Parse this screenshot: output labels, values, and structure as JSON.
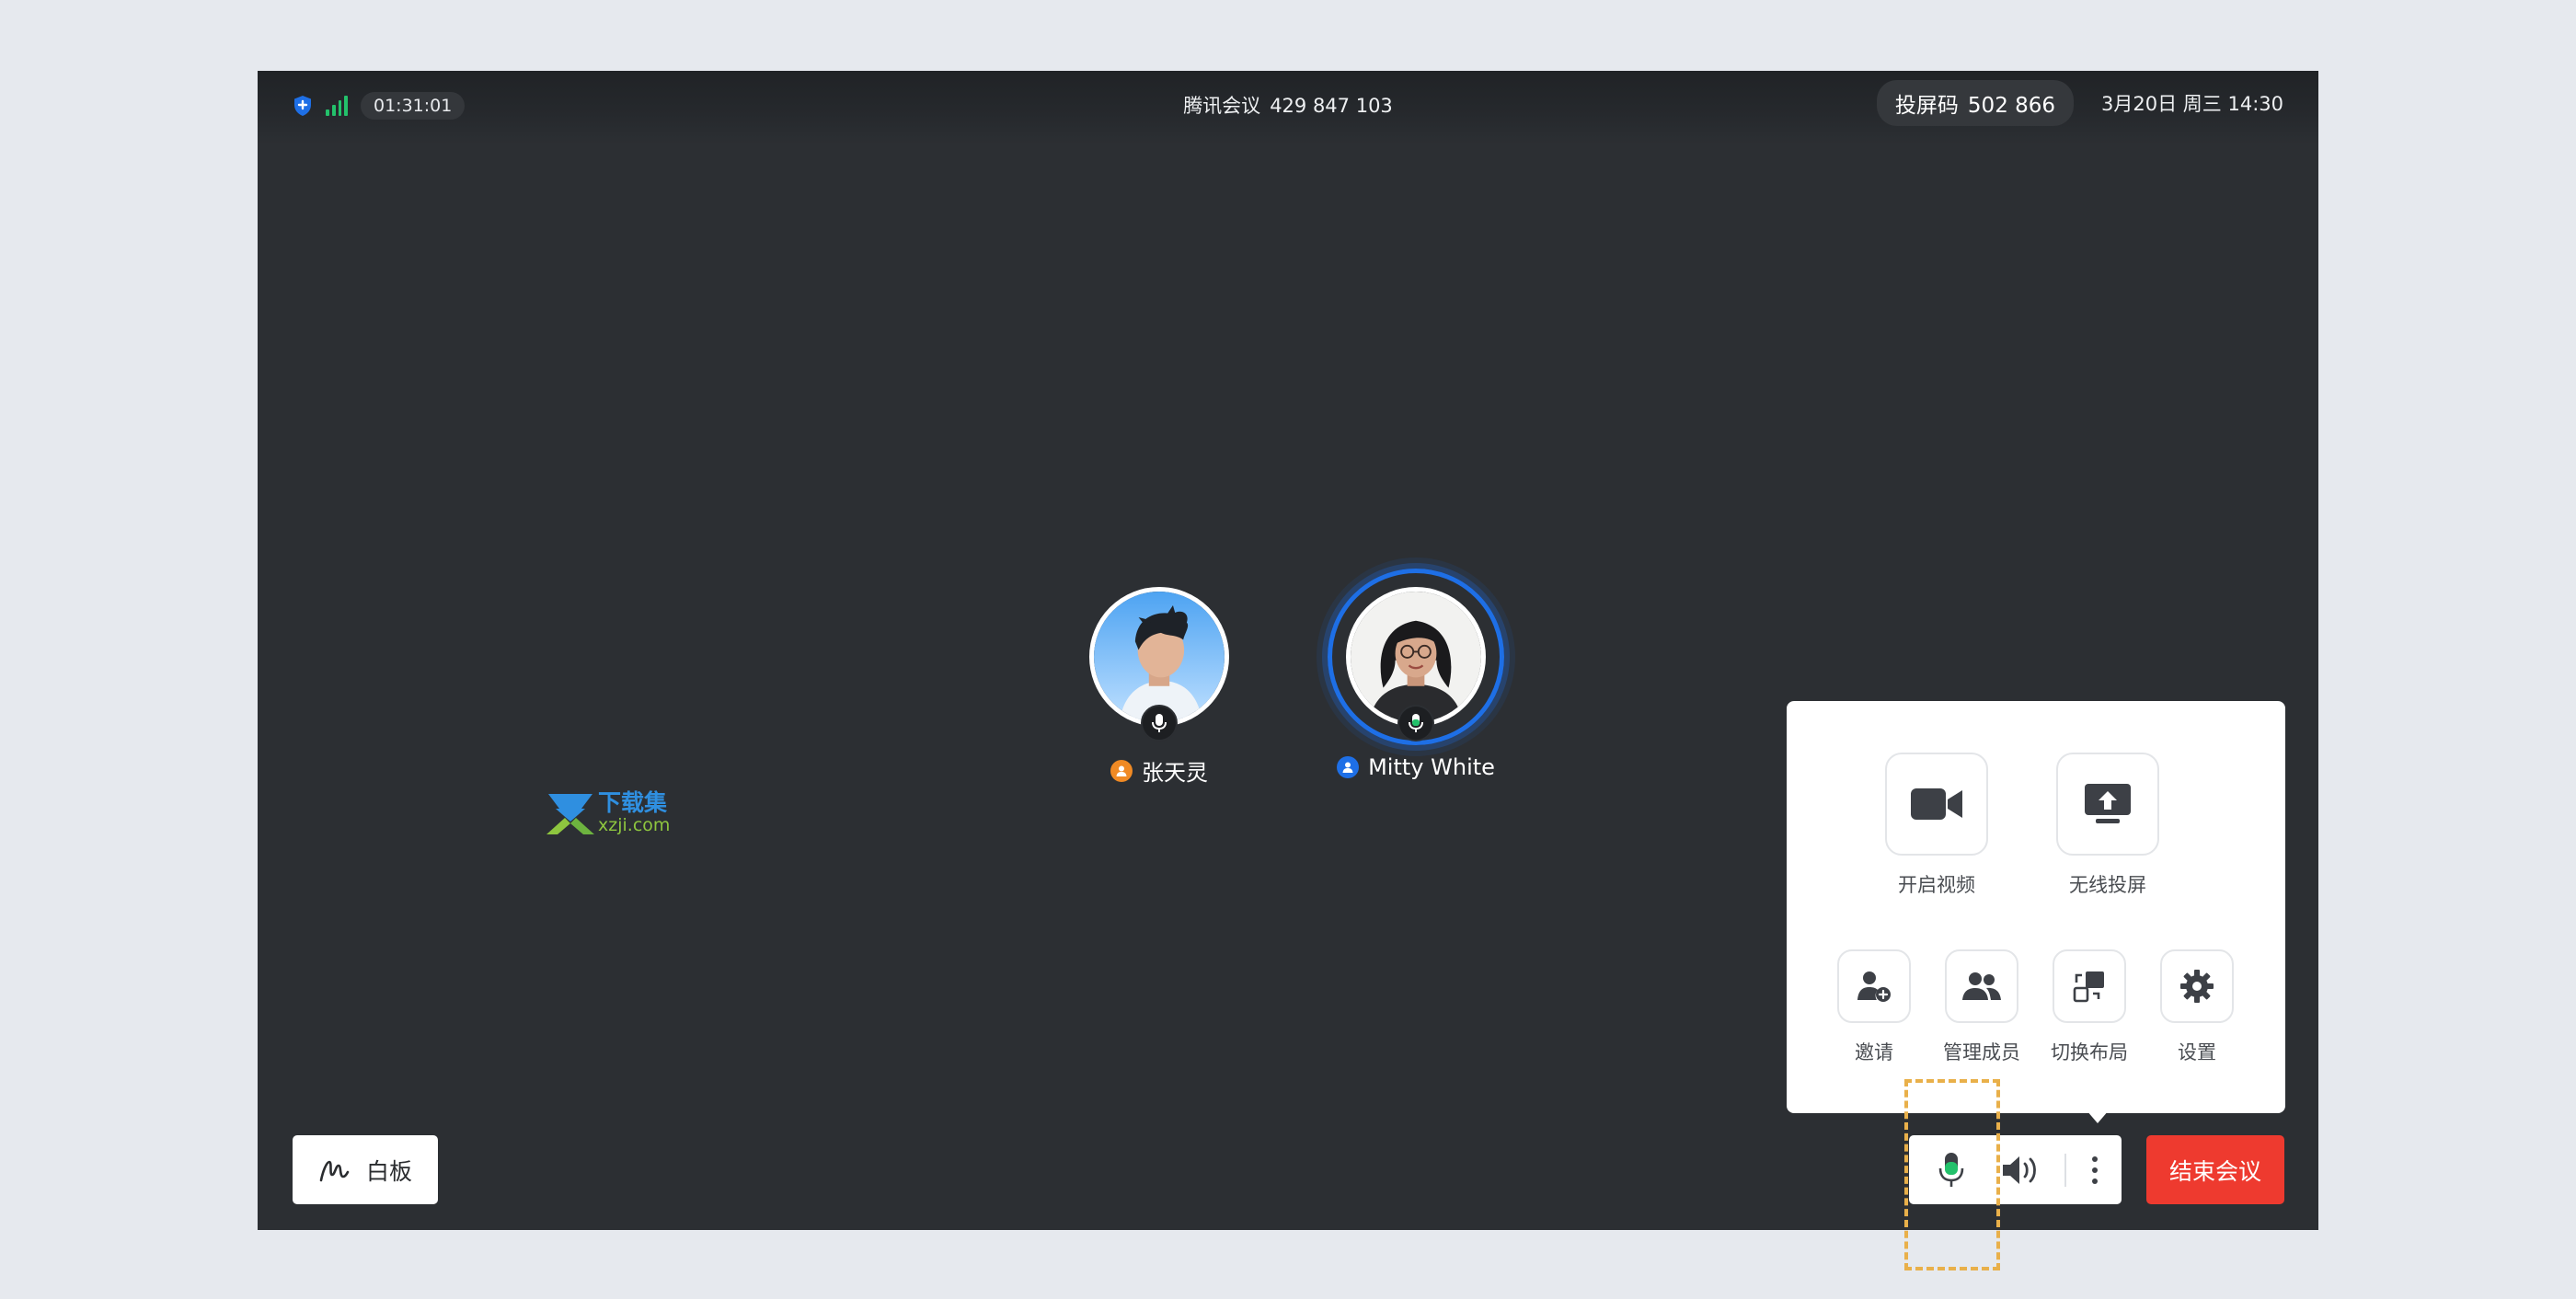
{
  "topbar": {
    "timer": "01:31:01",
    "app_name": "腾讯会议",
    "meeting_id": "429 847 103",
    "cast_label": "投屏码",
    "cast_code": "502 866",
    "datetime": "3月20日 周三 14:30"
  },
  "participants": [
    {
      "name": "张天灵",
      "badge_color": "#f08a24",
      "speaking": false
    },
    {
      "name": "Mitty White",
      "badge_color": "#1e6fe6",
      "speaking": true
    }
  ],
  "watermark": {
    "cn": "下载集",
    "domain": "xzji.com"
  },
  "whiteboard": {
    "label": "白板",
    "icon": "whiteboard-pen-icon"
  },
  "controls": {
    "mic_icon": "microphone-icon",
    "speaker_icon": "speaker-icon",
    "more_icon": "more-vertical-icon",
    "active_mic_color": "#23c16b"
  },
  "end_meeting": {
    "label": "结束会议",
    "color": "#ee3a2f"
  },
  "more_panel": {
    "primary": [
      {
        "label": "开启视频",
        "icon": "video-camera-icon"
      },
      {
        "label": "无线投屏",
        "icon": "screen-cast-icon"
      }
    ],
    "secondary": [
      {
        "label": "邀请",
        "icon": "invite-user-icon"
      },
      {
        "label": "管理成员",
        "icon": "members-icon"
      },
      {
        "label": "切换布局",
        "icon": "layout-switch-icon"
      },
      {
        "label": "设置",
        "icon": "gear-icon"
      }
    ]
  },
  "colors": {
    "highlight": "#e9b04a",
    "screen_bg": "#2c2f33",
    "accent_blue": "#1e6fe6"
  }
}
